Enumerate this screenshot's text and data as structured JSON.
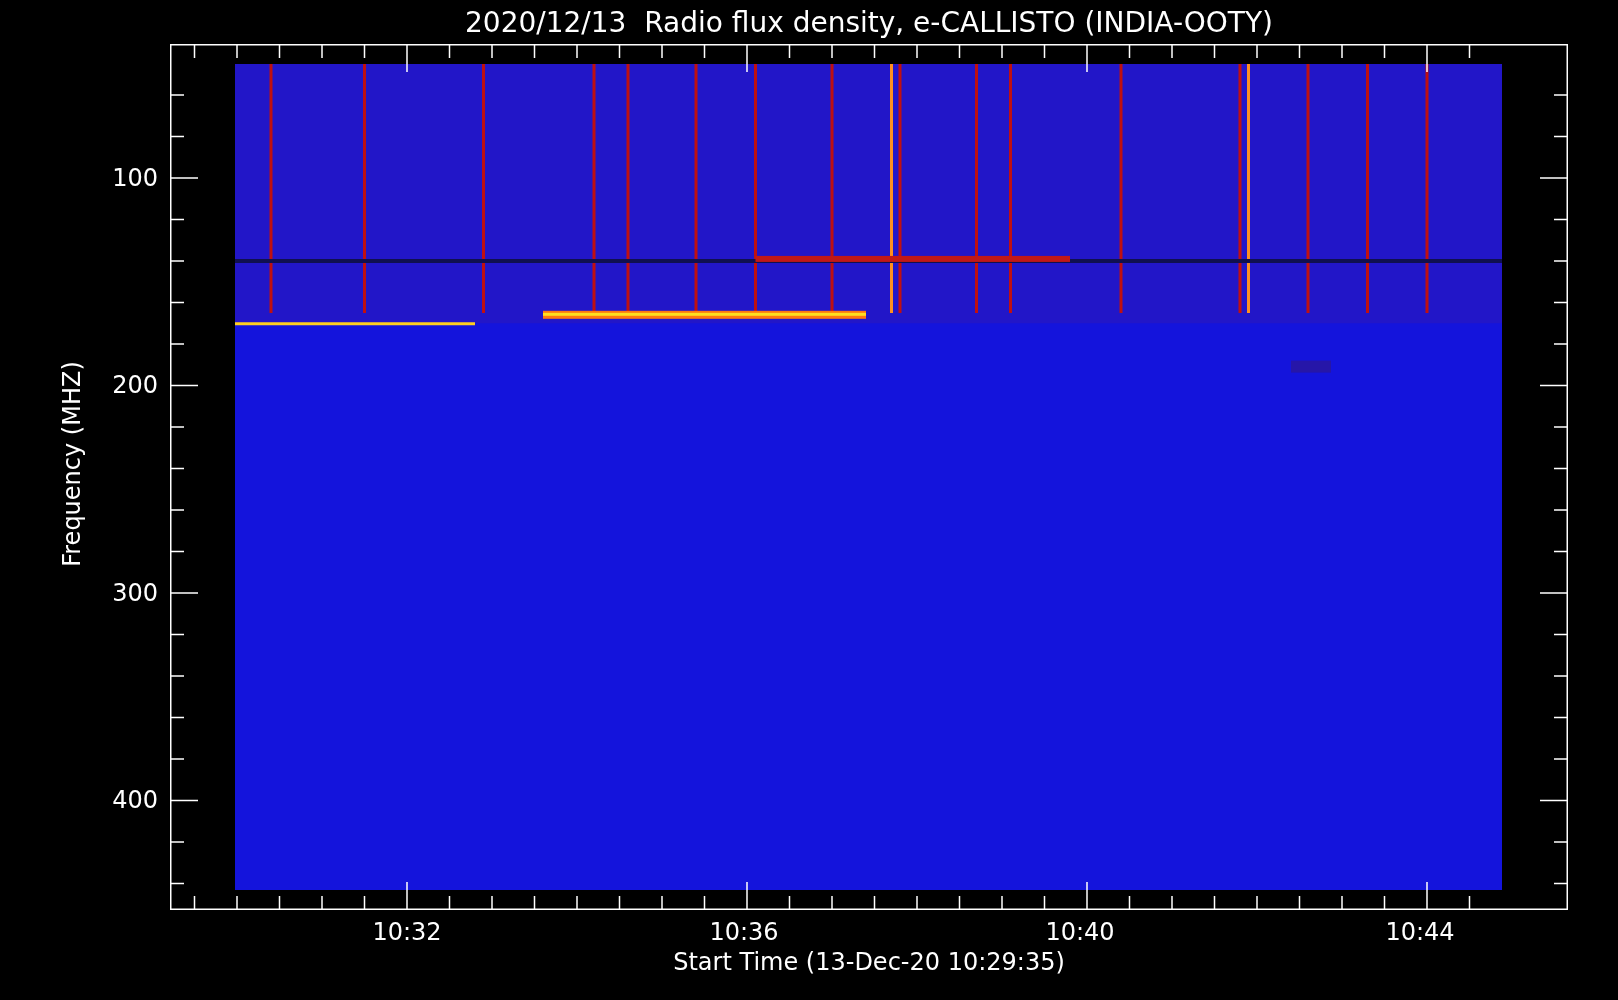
{
  "chart": {
    "title": "2020/12/13  Radio flux density, e-CALLISTO (INDIA-OOTY)",
    "ylabel": "Frequency (MHZ)",
    "xlabel": "Start Time (13-Dec-20 10:29:35)",
    "yticks": [
      "100",
      "200",
      "300",
      "400"
    ],
    "xticks": [
      "10:32",
      "10:36",
      "10:40",
      "10:44"
    ]
  }
}
